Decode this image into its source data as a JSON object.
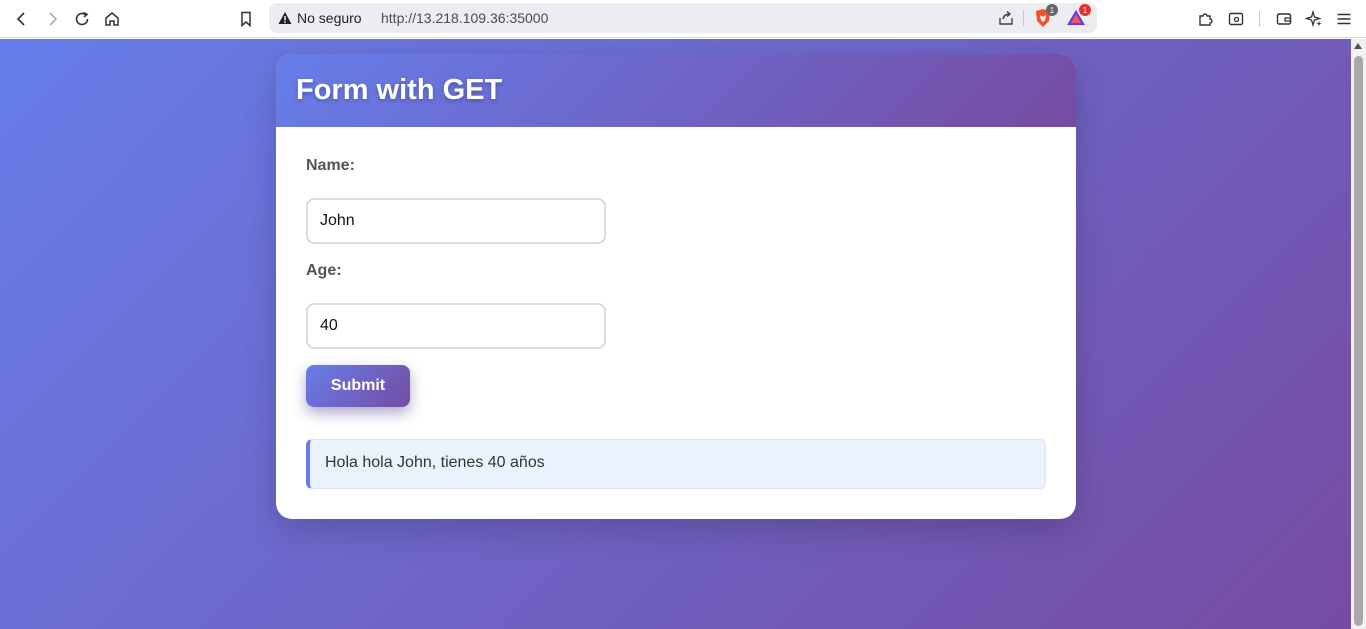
{
  "browser": {
    "security_label": "No seguro",
    "url": "http://13.218.109.36:35000",
    "brave_badge": "1",
    "alert_badge": "1"
  },
  "form": {
    "title": "Form with GET",
    "name_label": "Name:",
    "name_value": "John",
    "age_label": "Age:",
    "age_value": "40",
    "submit_label": "Submit"
  },
  "result": {
    "message": "Hola hola John, tienes 40 años"
  },
  "colors": {
    "gradient_start": "#667eea",
    "gradient_end": "#764ba2",
    "result_bg": "#eaf3fd"
  }
}
